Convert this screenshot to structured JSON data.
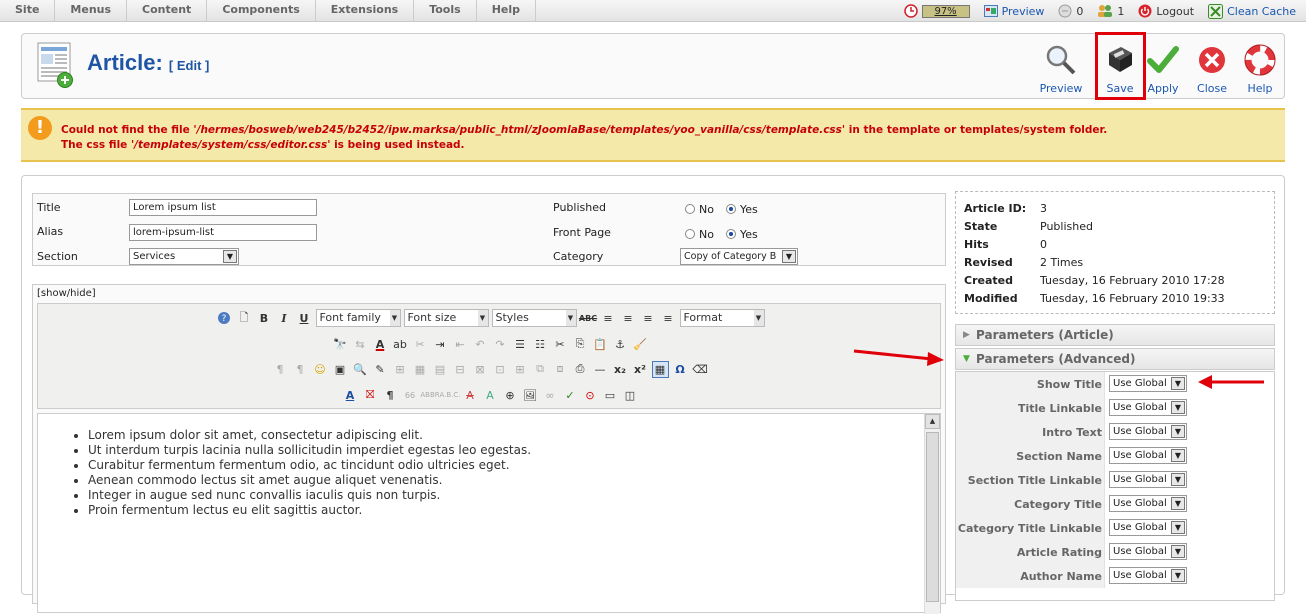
{
  "topbar": {
    "menus": [
      "Site",
      "Menus",
      "Content",
      "Components",
      "Extensions",
      "Tools",
      "Help"
    ],
    "memory": "97%",
    "preview": "Preview",
    "messages": "0",
    "users": "1",
    "logout": "Logout",
    "clean_cache": "Clean Cache"
  },
  "toolbar": {
    "title": "Article:",
    "subtitle": "[ Edit ]",
    "buttons": [
      "Preview",
      "Save",
      "Apply",
      "Close",
      "Help"
    ]
  },
  "warning": {
    "line1_pre": "Could not find the file ",
    "line1_path": "'/hermes/bosweb/web245/b2452/ipw.marksa/public_html/zJoomlaBase/templates/yoo_vanilla/css/template.css'",
    "line1_post": " in the template or templates/system folder.",
    "line2_pre": "The css file ",
    "line2_path": "'/templates/system/css/editor.css'",
    "line2_post": " is being used instead."
  },
  "details": {
    "title_label": "Title",
    "title_value": "Lorem ipsum list",
    "alias_label": "Alias",
    "alias_value": "lorem-ipsum-list",
    "section_label": "Section",
    "section_value": "Services",
    "published_label": "Published",
    "frontpage_label": "Front Page",
    "category_label": "Category",
    "category_value": "Copy of Category B",
    "no": "No",
    "yes": "Yes"
  },
  "editor": {
    "showhide": "[show/hide]",
    "font_family": "Font family",
    "font_size": "Font size",
    "styles": "Styles",
    "format": "Format",
    "content": [
      "Lorem ipsum dolor sit amet, consectetur adipiscing elit.",
      "Ut interdum turpis lacinia nulla sollicitudin imperdiet egestas leo egestas.",
      "Curabitur fermentum fermentum odio, ac tincidunt odio ultricies eget.",
      "Aenean commodo lectus sit amet augue aliquet venenatis.",
      "Integer in augue sed nunc convallis iaculis quis non turpis.",
      "Proin fermentum lectus eu elit sagittis auctor."
    ]
  },
  "info": {
    "rows": [
      {
        "k": "Article ID:",
        "v": "3"
      },
      {
        "k": "State",
        "v": "Published"
      },
      {
        "k": "Hits",
        "v": "0"
      },
      {
        "k": "Revised",
        "v": "2 Times"
      },
      {
        "k": "Created",
        "v": "Tuesday, 16 February 2010 17:28"
      },
      {
        "k": "Modified",
        "v": "Tuesday, 16 February 2010 19:33"
      }
    ]
  },
  "params": {
    "article_head": "Parameters (Article)",
    "advanced_head": "Parameters (Advanced)",
    "rows": [
      {
        "label": "Show Title",
        "value": "Use Global"
      },
      {
        "label": "Title Linkable",
        "value": "Use Global"
      },
      {
        "label": "Intro Text",
        "value": "Use Global"
      },
      {
        "label": "Section Name",
        "value": "Use Global"
      },
      {
        "label": "Section Title Linkable",
        "value": "Use Global"
      },
      {
        "label": "Category Title",
        "value": "Use Global"
      },
      {
        "label": "Category Title Linkable",
        "value": "Use Global"
      },
      {
        "label": "Article Rating",
        "value": "Use Global"
      },
      {
        "label": "Author Name",
        "value": "Use Global"
      }
    ]
  },
  "colors": {
    "link": "#1b57b1",
    "warning_text": "#c6000a",
    "warning_bg": "#f5e9a9",
    "highlight": "#e0000a"
  }
}
